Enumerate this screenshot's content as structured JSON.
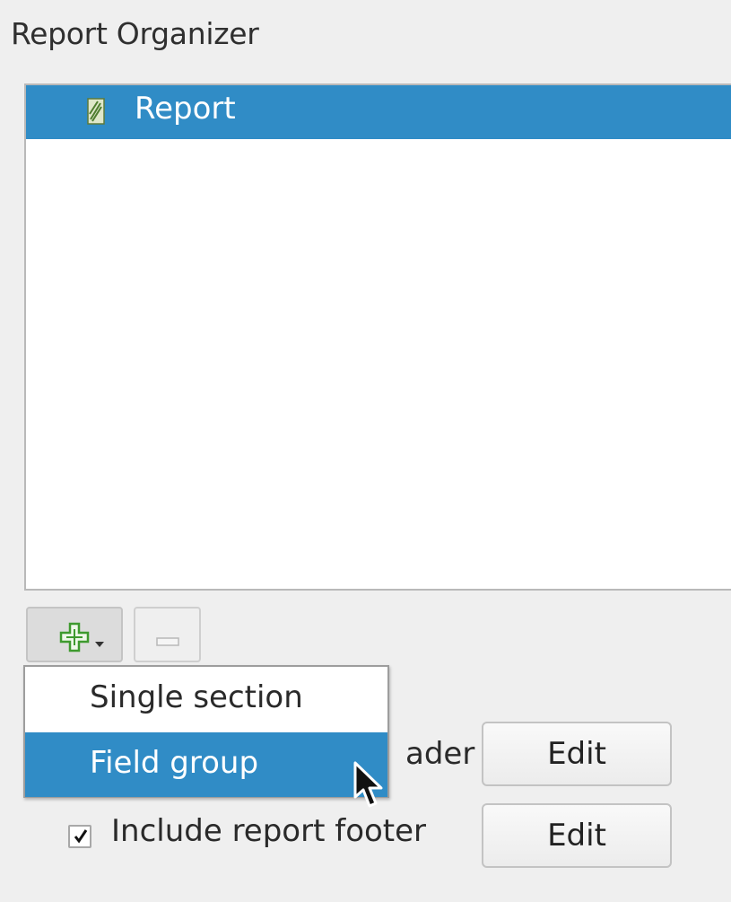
{
  "panel": {
    "title": "Report Organizer"
  },
  "tree": {
    "items": [
      {
        "label": "Report",
        "icon": "report-icon",
        "selected": true
      }
    ]
  },
  "toolbar": {
    "add_icon": "plus-icon",
    "add_dropdown_icon": "caret-down-icon",
    "remove_icon": "minus-icon"
  },
  "menu": {
    "items": [
      {
        "label": "Single section",
        "highlighted": false
      },
      {
        "label": "Field group",
        "highlighted": true
      }
    ]
  },
  "options": {
    "header_label_partial": "ader",
    "footer_label": "Include report footer",
    "footer_checked": true,
    "edit_label": "Edit"
  },
  "colors": {
    "selection": "#308cc6",
    "add_icon_green": "#3e9a2e"
  }
}
